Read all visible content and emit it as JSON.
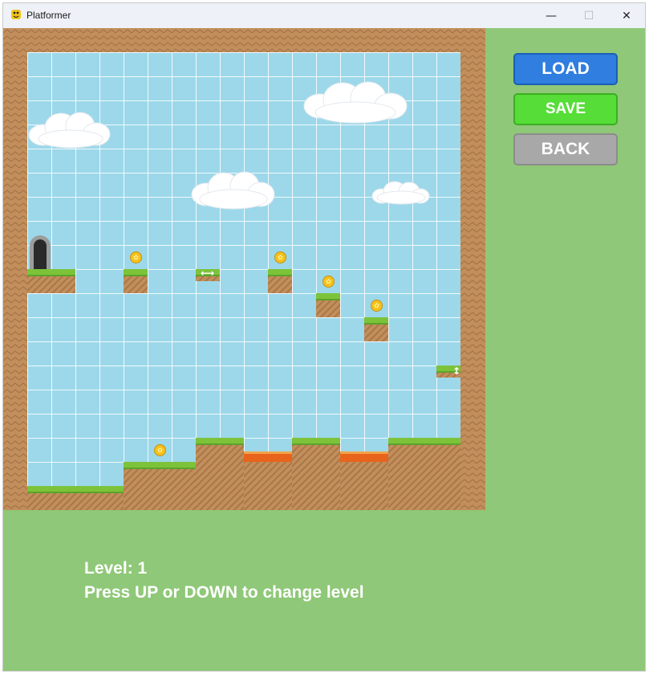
{
  "window": {
    "title": "Platformer",
    "minimize_glyph": "—",
    "maximize_glyph": "☐",
    "close_glyph": "✕"
  },
  "buttons": {
    "load": "LOAD",
    "save": "SAVE",
    "back": "BACK"
  },
  "info": {
    "level_text": "Level: 1",
    "instruction": "Press UP or DOWN to change level"
  },
  "level": {
    "number": 1,
    "grid_cells": 20,
    "icons": [
      "door-icon",
      "coin-icon",
      "cloud-icon",
      "horizontal-arrow-icon",
      "vertical-arrow-icon",
      "lava-icon"
    ]
  },
  "colors": {
    "background": "#8fc878",
    "sky": "#9cd8ea",
    "dirt": "#c28f5c",
    "grass": "#7cc33a",
    "lava": "#e8641c",
    "load_button": "#2f7ee0",
    "save_button": "#56dd37",
    "back_button": "#a8a8a8"
  }
}
